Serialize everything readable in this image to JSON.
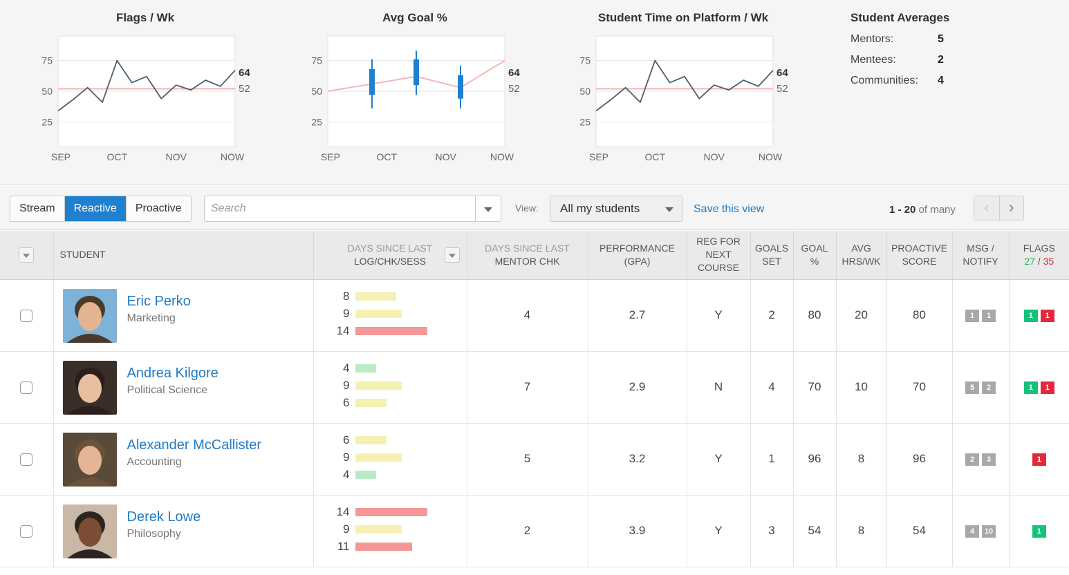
{
  "colors": {
    "accent": "#1f80d0",
    "link": "#1f7ac4",
    "line": "#4b5e6e",
    "reference_line": "#f4b6b6",
    "candle": "#1f80d0",
    "bar_yellow": "#f4f1b2",
    "bar_green": "#b9ebc7",
    "bar_red": "#f59698",
    "badge_gray": "#a8a8a8",
    "badge_green": "#16c27a",
    "badge_red": "#e02a3c"
  },
  "chart_data": [
    {
      "type": "line",
      "title": "Flags / Wk",
      "x_ticks": [
        "SEP",
        "OCT",
        "NOV",
        "NOW"
      ],
      "y_ticks": [
        25,
        50,
        75
      ],
      "ylim": [
        5,
        95
      ],
      "series": [
        {
          "values": [
            34,
            43,
            53,
            41,
            75,
            57,
            62,
            44,
            55,
            51,
            59,
            54,
            67
          ]
        }
      ],
      "reference_value": 52,
      "end_labels": [
        "64",
        "52"
      ]
    },
    {
      "type": "candlestick",
      "title": "Avg Goal %",
      "x_ticks": [
        "SEP",
        "OCT",
        "NOV",
        "NOW"
      ],
      "y_ticks": [
        25,
        50,
        75
      ],
      "ylim": [
        5,
        95
      ],
      "reference_series": {
        "x_frac": [
          0,
          0.5,
          0.75,
          1.0
        ],
        "values": [
          50,
          62,
          53,
          75
        ]
      },
      "candles": [
        {
          "x_frac": 0.25,
          "low": 36,
          "high": 76,
          "open": 47,
          "close": 68
        },
        {
          "x_frac": 0.5,
          "low": 47,
          "high": 83,
          "open": 55,
          "close": 76
        },
        {
          "x_frac": 0.75,
          "low": 36,
          "high": 71,
          "open": 44,
          "close": 63
        }
      ],
      "end_labels": [
        "64",
        "52"
      ]
    },
    {
      "type": "line",
      "title": "Student Time on Platform / Wk",
      "x_ticks": [
        "SEP",
        "OCT",
        "NOV",
        "NOW"
      ],
      "y_ticks": [
        25,
        50,
        75
      ],
      "ylim": [
        5,
        95
      ],
      "series": [
        {
          "values": [
            34,
            43,
            53,
            41,
            75,
            57,
            62,
            44,
            55,
            51,
            59,
            54,
            67
          ]
        }
      ],
      "reference_value": 52,
      "end_labels": [
        "64",
        "52"
      ]
    }
  ],
  "averages": {
    "title": "Student Averages",
    "rows": [
      {
        "label": "Mentors:",
        "value": "5"
      },
      {
        "label": "Mentees:",
        "value": "2"
      },
      {
        "label": "Communities:",
        "value": "4"
      }
    ]
  },
  "toolbar": {
    "tabs": [
      {
        "label": "Stream",
        "active": false
      },
      {
        "label": "Reactive",
        "active": true
      },
      {
        "label": "Proactive",
        "active": false
      }
    ],
    "search_placeholder": "Search",
    "view_label": "View:",
    "view_value": "All my students",
    "save_view": "Save this view",
    "range": "1 - 20",
    "range_suffix": " of many",
    "prev": "‹",
    "next": "›"
  },
  "table": {
    "headers": {
      "student": "STUDENT",
      "days_log_1": "DAYS SINCE LAST",
      "days_log_2": "LOG/CHK/SESS",
      "days_mentor_1": "DAYS SINCE LAST",
      "days_mentor_2": "MENTOR CHK",
      "perf_1": "PERFORMANCE",
      "perf_2": "(GPA)",
      "reg_1": "REG FOR",
      "reg_2": "NEXT",
      "reg_3": "COURSE",
      "goals_1": "GOALS",
      "goals_2": "SET",
      "goalpct_1": "GOAL",
      "goalpct_2": "%",
      "avg_1": "AVG",
      "avg_2": "HRS/WK",
      "pro_1": "PROACTIVE",
      "pro_2": "SCORE",
      "msg_1": "MSG /",
      "msg_2": "NOTIFY",
      "flags": "FLAGS",
      "flags_green": "27",
      "flags_sep": " / ",
      "flags_red": "35"
    },
    "bar_scale_max": 14,
    "rows": [
      {
        "name": "Eric Perko",
        "major": "Marketing",
        "days": [
          {
            "value": 8,
            "color": "yellow"
          },
          {
            "value": 9,
            "color": "yellow"
          },
          {
            "value": 14,
            "color": "red"
          }
        ],
        "mentor_chk": "4",
        "gpa": "2.7",
        "reg": "Y",
        "goals_set": "2",
        "goal_pct": "80",
        "avg_hrs": "20",
        "proactive": "80",
        "msg": [
          "1",
          "1"
        ],
        "flags": [
          {
            "v": "1",
            "c": "green"
          },
          {
            "v": "1",
            "c": "red"
          }
        ]
      },
      {
        "name": "Andrea Kilgore",
        "major": "Political Science",
        "days": [
          {
            "value": 4,
            "color": "green"
          },
          {
            "value": 9,
            "color": "yellow"
          },
          {
            "value": 6,
            "color": "yellow"
          }
        ],
        "mentor_chk": "7",
        "gpa": "2.9",
        "reg": "N",
        "goals_set": "4",
        "goal_pct": "70",
        "avg_hrs": "10",
        "proactive": "70",
        "msg": [
          "5",
          "2"
        ],
        "flags": [
          {
            "v": "1",
            "c": "green"
          },
          {
            "v": "1",
            "c": "red"
          }
        ]
      },
      {
        "name": "Alexander McCallister",
        "major": "Accounting",
        "days": [
          {
            "value": 6,
            "color": "yellow"
          },
          {
            "value": 9,
            "color": "yellow"
          },
          {
            "value": 4,
            "color": "green"
          }
        ],
        "mentor_chk": "5",
        "gpa": "3.2",
        "reg": "Y",
        "goals_set": "1",
        "goal_pct": "96",
        "avg_hrs": "8",
        "proactive": "96",
        "msg": [
          "2",
          "3"
        ],
        "flags": [
          {
            "v": "1",
            "c": "red"
          }
        ]
      },
      {
        "name": "Derek Lowe",
        "major": "Philosophy",
        "days": [
          {
            "value": 14,
            "color": "red"
          },
          {
            "value": 9,
            "color": "yellow"
          },
          {
            "value": 11,
            "color": "red"
          }
        ],
        "mentor_chk": "2",
        "gpa": "3.9",
        "reg": "Y",
        "goals_set": "3",
        "goal_pct": "54",
        "avg_hrs": "8",
        "proactive": "54",
        "msg": [
          "4",
          "10"
        ],
        "flags": [
          {
            "v": "1",
            "c": "green"
          }
        ]
      }
    ]
  }
}
